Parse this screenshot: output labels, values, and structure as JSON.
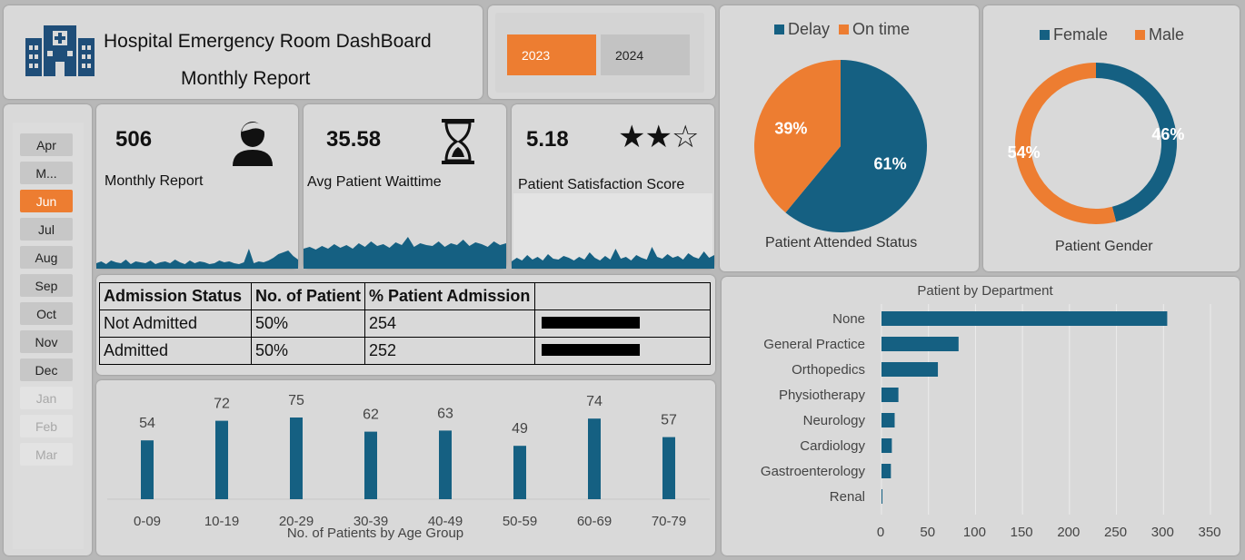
{
  "header": {
    "title": "Hospital Emergency Room DashBoard",
    "subtitle": "Monthly Report"
  },
  "years": [
    {
      "label": "2023",
      "active": true
    },
    {
      "label": "2024",
      "active": false
    }
  ],
  "months": [
    {
      "label": "Apr",
      "state": "normal"
    },
    {
      "label": "M...",
      "state": "normal"
    },
    {
      "label": "Jun",
      "state": "active"
    },
    {
      "label": "Jul",
      "state": "normal"
    },
    {
      "label": "Aug",
      "state": "normal"
    },
    {
      "label": "Sep",
      "state": "normal"
    },
    {
      "label": "Oct",
      "state": "normal"
    },
    {
      "label": "Nov",
      "state": "normal"
    },
    {
      "label": "Dec",
      "state": "normal"
    },
    {
      "label": "Jan",
      "state": "disabled"
    },
    {
      "label": "Feb",
      "state": "disabled"
    },
    {
      "label": "Mar",
      "state": "disabled"
    }
  ],
  "kpis": {
    "patients": {
      "value": "506",
      "label": "Monthly Report",
      "icon": "person-icon"
    },
    "wait": {
      "value": "35.58",
      "label": "Avg Patient Waittime",
      "icon": "hourglass-icon"
    },
    "satisfaction": {
      "value": "5.18",
      "label": "Patient Satisfaction Score",
      "icon": "stars-icon",
      "stars": "★★☆"
    }
  },
  "colors": {
    "blue": "#156082",
    "orange": "#ed7d31"
  },
  "admission": {
    "headers": [
      "Admission Status",
      "No. of Patient",
      "% Patient Admission",
      ""
    ],
    "rows": [
      {
        "status": "Not Admitted",
        "count": "50%",
        "pct": "254",
        "bar": 0.5
      },
      {
        "status": "Admitted",
        "count": "50%",
        "pct": "252",
        "bar": 0.5
      }
    ]
  },
  "chart_data": [
    {
      "type": "pie",
      "title": "Patient Attended Status",
      "legend_position": "top",
      "slices": [
        {
          "name": "Delay",
          "value": 61,
          "label": "61%"
        },
        {
          "name": "On time",
          "value": 39,
          "label": "39%"
        }
      ]
    },
    {
      "type": "pie",
      "subtype": "donut",
      "title": "Patient Gender",
      "legend_position": "top",
      "slices": [
        {
          "name": "Female",
          "value": 46,
          "label": "46%"
        },
        {
          "name": "Male",
          "value": 54,
          "label": "54%"
        }
      ]
    },
    {
      "type": "bar",
      "title": "No. of Patients by Age Group",
      "categories": [
        "0-09",
        "10-19",
        "20-29",
        "30-39",
        "40-49",
        "50-59",
        "60-69",
        "70-79"
      ],
      "values": [
        54,
        72,
        75,
        62,
        63,
        49,
        74,
        57
      ],
      "ylim": [
        0,
        90
      ]
    },
    {
      "type": "bar",
      "orientation": "horizontal",
      "title": "Patient by Department",
      "categories": [
        "None",
        "General Practice",
        "Orthopedics",
        "Physiotherapy",
        "Neurology",
        "Cardiology",
        "Gastroenterology",
        "Renal"
      ],
      "values": [
        304,
        82,
        60,
        18,
        14,
        11,
        10,
        1
      ],
      "xlim": [
        0,
        350
      ],
      "xticks": [
        "0",
        "50",
        "100",
        "150",
        "200",
        "250",
        "300",
        "350"
      ],
      "grid": true
    }
  ],
  "sparklines": {
    "patients": [
      6,
      8,
      5,
      9,
      7,
      6,
      10,
      5,
      8,
      7,
      6,
      9,
      5,
      7,
      8,
      6,
      10,
      7,
      5,
      9,
      6,
      8,
      7,
      5,
      6,
      9,
      7,
      8,
      6,
      5,
      7,
      22,
      6,
      8,
      7,
      9,
      12,
      16,
      18,
      20,
      14,
      10
    ],
    "wait": [
      22,
      24,
      21,
      25,
      22,
      27,
      23,
      26,
      22,
      28,
      24,
      30,
      25,
      27,
      23,
      29,
      26,
      35,
      24,
      28,
      26,
      25,
      30,
      24,
      28,
      26,
      32,
      25,
      29,
      27,
      24,
      30,
      26,
      28
    ],
    "satisfaction": [
      8,
      12,
      9,
      15,
      10,
      13,
      9,
      16,
      11,
      10,
      14,
      12,
      9,
      13,
      10,
      18,
      12,
      9,
      14,
      10,
      22,
      11,
      13,
      9,
      15,
      12,
      10,
      24,
      13,
      11,
      16,
      12,
      14,
      10,
      17,
      13,
      11,
      19,
      12,
      15
    ]
  }
}
